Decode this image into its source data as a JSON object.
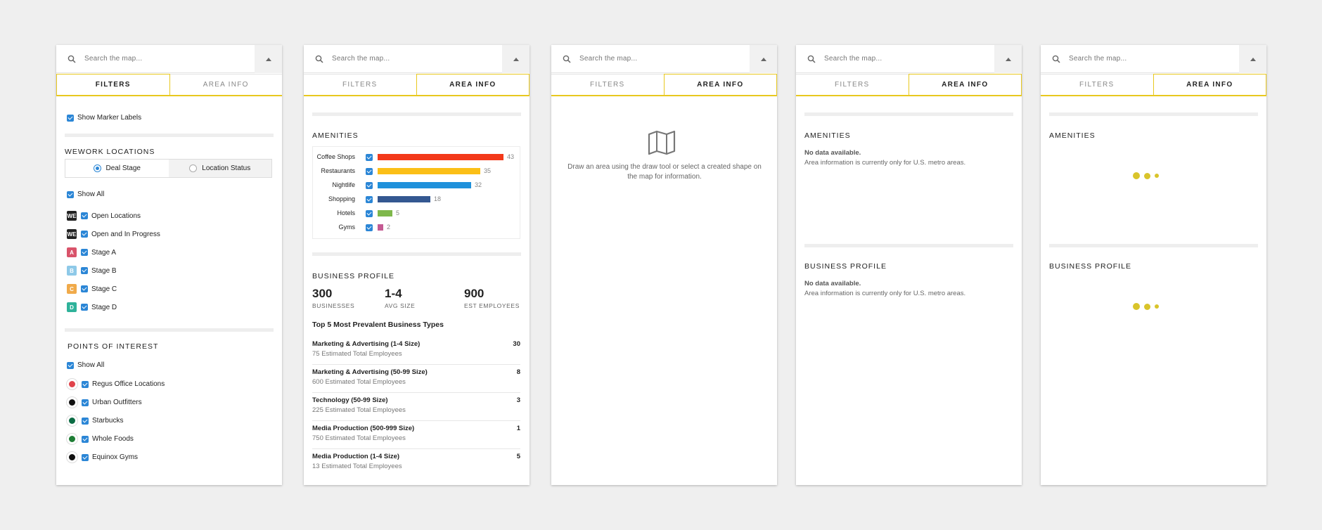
{
  "common": {
    "search_placeholder": "Search the map...",
    "tab_filters": "FILTERS",
    "tab_area_info": "AREA INFO"
  },
  "filters": {
    "show_marker_labels": "Show Marker Labels",
    "wework_title": "WEWORK LOCATIONS",
    "seg_deal_stage": "Deal Stage",
    "seg_location_status": "Location Status",
    "show_all": "Show All",
    "locations": [
      {
        "label": "Open Locations",
        "badge": "WE",
        "color": "#222222"
      },
      {
        "label": "Open and In Progress",
        "badge": "WE",
        "color": "#222222"
      },
      {
        "label": "Stage A",
        "badge": "A",
        "color": "#d9536a"
      },
      {
        "label": "Stage B",
        "badge": "B",
        "color": "#8ec9e8"
      },
      {
        "label": "Stage C",
        "badge": "C",
        "color": "#f0aa4a"
      },
      {
        "label": "Stage D",
        "badge": "D",
        "color": "#2fb29a"
      }
    ],
    "poi_title": "POINTS OF INTEREST",
    "poi_show_all": "Show All",
    "pois": [
      {
        "label": "Regus Office Locations",
        "color": "#e0434b"
      },
      {
        "label": "Urban Outfitters",
        "color": "#111111"
      },
      {
        "label": "Starbucks",
        "color": "#0b6b43"
      },
      {
        "label": "Whole Foods",
        "color": "#1e7d35"
      },
      {
        "label": "Equinox Gyms",
        "color": "#111111"
      }
    ]
  },
  "amenities": {
    "title": "AMENITIES",
    "items": [
      {
        "label": "Coffee Shops",
        "value": 43,
        "display": "43",
        "color": "#f3391a"
      },
      {
        "label": "Restaurants",
        "value": 35,
        "display": "35",
        "color": "#fbbf17"
      },
      {
        "label": "Nightlife",
        "value": 32,
        "display": "32",
        "color": "#1f91db"
      },
      {
        "label": "Shopping",
        "value": 18,
        "display": "18",
        "color": "#345891"
      },
      {
        "label": "Hotels",
        "value": 5,
        "display": "5",
        "color": "#7fb84b"
      },
      {
        "label": "Gyms",
        "value": 2,
        "display": "2",
        "color": "#c45a92"
      }
    ]
  },
  "business": {
    "title": "BUSINESS PROFILE",
    "stats": [
      {
        "value": "300",
        "label": "BUSINESSES"
      },
      {
        "value": "1-4",
        "label": "AVG SIZE"
      },
      {
        "value": "900",
        "label": "EST EMPLOYEES"
      }
    ],
    "top_title": "Top 5 Most Prevalent Business Types",
    "types": [
      {
        "name": "Marketing & Advertising (1-4 Size)",
        "sub": "75 Estimated Total Employees",
        "count": "30"
      },
      {
        "name": "Marketing & Advertising (50-99 Size)",
        "sub": "600 Estimated Total Employees",
        "count": "8"
      },
      {
        "name": "Technology (50-99 Size)",
        "sub": "225 Estimated Total Employees",
        "count": "3"
      },
      {
        "name": "Media Production (500-999 Size)",
        "sub": "750 Estimated Total Employees",
        "count": "1"
      },
      {
        "name": "Media Production (1-4 Size)",
        "sub": "13 Estimated Total Employees",
        "count": "5"
      }
    ]
  },
  "empty_state": {
    "message": "Draw an area using the draw tool or select a created shape on the map for information."
  },
  "no_data": {
    "title": "No data available.",
    "sub": "Area information is currently only for U.S. metro areas."
  },
  "colors": {
    "accent": "#e8c81f",
    "checkbox": "#2b86d6",
    "loader": "#d9c42b"
  }
}
